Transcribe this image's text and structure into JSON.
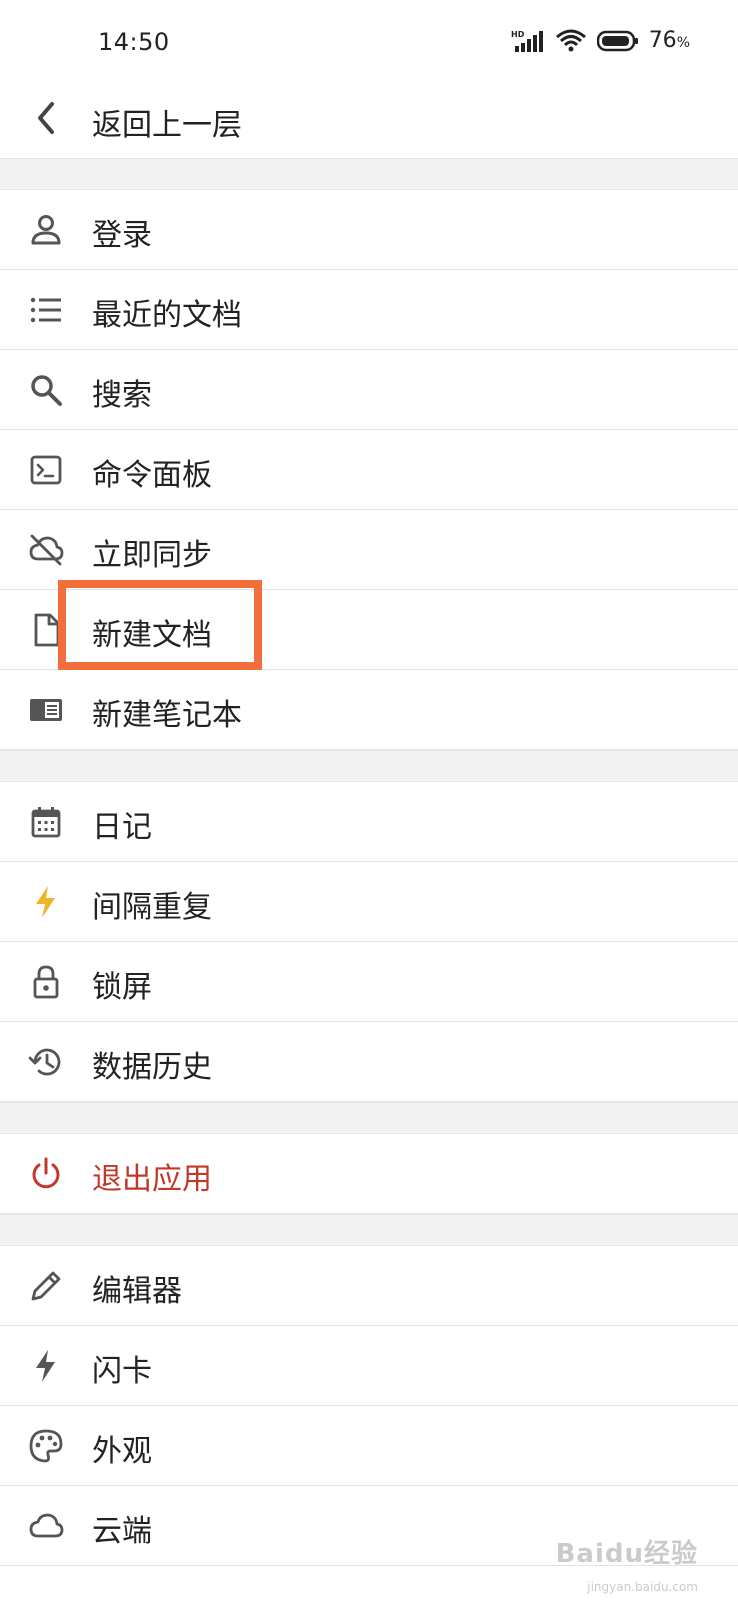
{
  "status_bar": {
    "time": "14:50",
    "network": "HD",
    "battery_percent": "76",
    "battery_unit": "%"
  },
  "header": {
    "back_label": "返回上一层"
  },
  "menu": {
    "items": [
      {
        "label": "登录",
        "icon": "person-icon"
      },
      {
        "label": "最近的文档",
        "icon": "list-icon"
      },
      {
        "label": "搜索",
        "icon": "search-icon"
      },
      {
        "label": "命令面板",
        "icon": "terminal-icon"
      },
      {
        "label": "立即同步",
        "icon": "cloud-off-icon"
      },
      {
        "label": "新建文档",
        "icon": "document-icon"
      },
      {
        "label": "新建笔记本",
        "icon": "notebook-icon"
      },
      {
        "label": "日记",
        "icon": "calendar-icon"
      },
      {
        "label": "间隔重复",
        "icon": "bolt-icon"
      },
      {
        "label": "锁屏",
        "icon": "lock-icon"
      },
      {
        "label": "数据历史",
        "icon": "history-icon"
      },
      {
        "label": "退出应用",
        "icon": "power-icon"
      },
      {
        "label": "编辑器",
        "icon": "pencil-icon"
      },
      {
        "label": "闪卡",
        "icon": "flash-icon"
      },
      {
        "label": "外观",
        "icon": "palette-icon"
      },
      {
        "label": "云端",
        "icon": "cloud-icon"
      }
    ]
  },
  "colors": {
    "highlight": "#f26f3c",
    "danger": "#c0392b",
    "accent_bolt": "#f0b429"
  },
  "watermark": {
    "brand": "Baidu经验",
    "url": "jingyan.baidu.com"
  }
}
